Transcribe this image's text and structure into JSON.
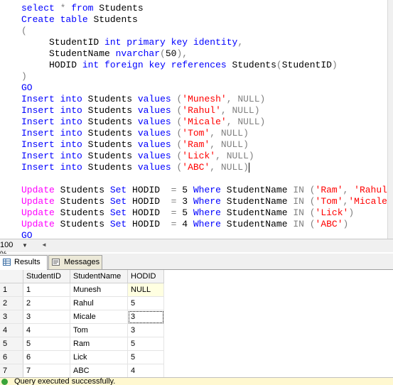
{
  "editor": {
    "lines": [
      {
        "segments": [
          {
            "t": "select",
            "c": "kw"
          },
          {
            "t": " ",
            "c": ""
          },
          {
            "t": "*",
            "c": "op"
          },
          {
            "t": " ",
            "c": ""
          },
          {
            "t": "from",
            "c": "kw"
          },
          {
            "t": " Students",
            "c": ""
          }
        ]
      },
      {
        "segments": [
          {
            "t": "Create",
            "c": "kw"
          },
          {
            "t": " ",
            "c": ""
          },
          {
            "t": "table",
            "c": "kw"
          },
          {
            "t": " Students",
            "c": ""
          }
        ]
      },
      {
        "segments": [
          {
            "t": "(",
            "c": "op"
          }
        ]
      },
      {
        "segments": [
          {
            "t": "     StudentID ",
            "c": ""
          },
          {
            "t": "int",
            "c": "kw"
          },
          {
            "t": " ",
            "c": ""
          },
          {
            "t": "primary",
            "c": "kw"
          },
          {
            "t": " ",
            "c": ""
          },
          {
            "t": "key",
            "c": "kw"
          },
          {
            "t": " ",
            "c": ""
          },
          {
            "t": "identity",
            "c": "kw"
          },
          {
            "t": ",",
            "c": "op"
          }
        ]
      },
      {
        "segments": [
          {
            "t": "     StudentName ",
            "c": ""
          },
          {
            "t": "nvarchar",
            "c": "kw"
          },
          {
            "t": "(",
            "c": "op"
          },
          {
            "t": "50",
            "c": ""
          },
          {
            "t": "),",
            "c": "op"
          }
        ]
      },
      {
        "segments": [
          {
            "t": "     HODID ",
            "c": ""
          },
          {
            "t": "int",
            "c": "kw"
          },
          {
            "t": " ",
            "c": ""
          },
          {
            "t": "foreign",
            "c": "kw"
          },
          {
            "t": " ",
            "c": ""
          },
          {
            "t": "key",
            "c": "kw"
          },
          {
            "t": " ",
            "c": ""
          },
          {
            "t": "references",
            "c": "kw"
          },
          {
            "t": " Students",
            "c": ""
          },
          {
            "t": "(",
            "c": "op"
          },
          {
            "t": "StudentID",
            "c": ""
          },
          {
            "t": ")",
            "c": "op"
          }
        ]
      },
      {
        "segments": [
          {
            "t": ")",
            "c": "op"
          }
        ]
      },
      {
        "segments": [
          {
            "t": "GO",
            "c": "kw"
          }
        ]
      },
      {
        "segments": [
          {
            "t": "Insert",
            "c": "kw"
          },
          {
            "t": " ",
            "c": ""
          },
          {
            "t": "into",
            "c": "kw"
          },
          {
            "t": " Students ",
            "c": ""
          },
          {
            "t": "values",
            "c": "kw"
          },
          {
            "t": " (",
            "c": "op"
          },
          {
            "t": "'Munesh'",
            "c": "str"
          },
          {
            "t": ", ",
            "c": "op"
          },
          {
            "t": "NULL",
            "c": "op"
          },
          {
            "t": ")",
            "c": "op"
          }
        ]
      },
      {
        "segments": [
          {
            "t": "Insert",
            "c": "kw"
          },
          {
            "t": " ",
            "c": ""
          },
          {
            "t": "into",
            "c": "kw"
          },
          {
            "t": " Students ",
            "c": ""
          },
          {
            "t": "values",
            "c": "kw"
          },
          {
            "t": " (",
            "c": "op"
          },
          {
            "t": "'Rahul'",
            "c": "str"
          },
          {
            "t": ", ",
            "c": "op"
          },
          {
            "t": "NULL",
            "c": "op"
          },
          {
            "t": ")",
            "c": "op"
          }
        ]
      },
      {
        "segments": [
          {
            "t": "Insert",
            "c": "kw"
          },
          {
            "t": " ",
            "c": ""
          },
          {
            "t": "into",
            "c": "kw"
          },
          {
            "t": " Students ",
            "c": ""
          },
          {
            "t": "values",
            "c": "kw"
          },
          {
            "t": " (",
            "c": "op"
          },
          {
            "t": "'Micale'",
            "c": "str"
          },
          {
            "t": ", ",
            "c": "op"
          },
          {
            "t": "NULL",
            "c": "op"
          },
          {
            "t": ")",
            "c": "op"
          }
        ]
      },
      {
        "segments": [
          {
            "t": "Insert",
            "c": "kw"
          },
          {
            "t": " ",
            "c": ""
          },
          {
            "t": "into",
            "c": "kw"
          },
          {
            "t": " Students ",
            "c": ""
          },
          {
            "t": "values",
            "c": "kw"
          },
          {
            "t": " (",
            "c": "op"
          },
          {
            "t": "'Tom'",
            "c": "str"
          },
          {
            "t": ", ",
            "c": "op"
          },
          {
            "t": "NULL",
            "c": "op"
          },
          {
            "t": ")",
            "c": "op"
          }
        ]
      },
      {
        "segments": [
          {
            "t": "Insert",
            "c": "kw"
          },
          {
            "t": " ",
            "c": ""
          },
          {
            "t": "into",
            "c": "kw"
          },
          {
            "t": " Students ",
            "c": ""
          },
          {
            "t": "values",
            "c": "kw"
          },
          {
            "t": " (",
            "c": "op"
          },
          {
            "t": "'Ram'",
            "c": "str"
          },
          {
            "t": ", ",
            "c": "op"
          },
          {
            "t": "NULL",
            "c": "op"
          },
          {
            "t": ")",
            "c": "op"
          }
        ]
      },
      {
        "segments": [
          {
            "t": "Insert",
            "c": "kw"
          },
          {
            "t": " ",
            "c": ""
          },
          {
            "t": "into",
            "c": "kw"
          },
          {
            "t": " Students ",
            "c": ""
          },
          {
            "t": "values",
            "c": "kw"
          },
          {
            "t": " (",
            "c": "op"
          },
          {
            "t": "'Lick'",
            "c": "str"
          },
          {
            "t": ", ",
            "c": "op"
          },
          {
            "t": "NULL",
            "c": "op"
          },
          {
            "t": ")",
            "c": "op"
          }
        ]
      },
      {
        "segments": [
          {
            "t": "Insert",
            "c": "kw"
          },
          {
            "t": " ",
            "c": ""
          },
          {
            "t": "into",
            "c": "kw"
          },
          {
            "t": " Students ",
            "c": ""
          },
          {
            "t": "values",
            "c": "kw"
          },
          {
            "t": " (",
            "c": "op"
          },
          {
            "t": "'ABC'",
            "c": "str"
          },
          {
            "t": ", ",
            "c": "op"
          },
          {
            "t": "NULL",
            "c": "op"
          },
          {
            "t": ")",
            "c": "op"
          }
        ],
        "caret": true
      },
      {
        "segments": []
      },
      {
        "segments": [
          {
            "t": "Update",
            "c": "fn"
          },
          {
            "t": " Students ",
            "c": ""
          },
          {
            "t": "Set",
            "c": "kw"
          },
          {
            "t": " HODID  ",
            "c": ""
          },
          {
            "t": "=",
            "c": "op"
          },
          {
            "t": " 5 ",
            "c": ""
          },
          {
            "t": "Where",
            "c": "kw"
          },
          {
            "t": " StudentName ",
            "c": ""
          },
          {
            "t": "IN",
            "c": "op"
          },
          {
            "t": " (",
            "c": "op"
          },
          {
            "t": "'Ram'",
            "c": "str"
          },
          {
            "t": ", ",
            "c": "op"
          },
          {
            "t": "'Rahul'",
            "c": "str"
          },
          {
            "t": ")",
            "c": "op"
          }
        ]
      },
      {
        "segments": [
          {
            "t": "Update",
            "c": "fn"
          },
          {
            "t": " Students ",
            "c": ""
          },
          {
            "t": "Set",
            "c": "kw"
          },
          {
            "t": " HODID  ",
            "c": ""
          },
          {
            "t": "=",
            "c": "op"
          },
          {
            "t": " 3 ",
            "c": ""
          },
          {
            "t": "Where",
            "c": "kw"
          },
          {
            "t": " StudentName ",
            "c": ""
          },
          {
            "t": "IN",
            "c": "op"
          },
          {
            "t": " (",
            "c": "op"
          },
          {
            "t": "'Tom'",
            "c": "str"
          },
          {
            "t": ",",
            "c": "op"
          },
          {
            "t": "'Micale'",
            "c": "str"
          },
          {
            "t": ")",
            "c": "op"
          }
        ]
      },
      {
        "segments": [
          {
            "t": "Update",
            "c": "fn"
          },
          {
            "t": " Students ",
            "c": ""
          },
          {
            "t": "Set",
            "c": "kw"
          },
          {
            "t": " HODID  ",
            "c": ""
          },
          {
            "t": "=",
            "c": "op"
          },
          {
            "t": " 5 ",
            "c": ""
          },
          {
            "t": "Where",
            "c": "kw"
          },
          {
            "t": " StudentName ",
            "c": ""
          },
          {
            "t": "IN",
            "c": "op"
          },
          {
            "t": " (",
            "c": "op"
          },
          {
            "t": "'Lick'",
            "c": "str"
          },
          {
            "t": ")",
            "c": "op"
          }
        ]
      },
      {
        "segments": [
          {
            "t": "Update",
            "c": "fn"
          },
          {
            "t": " Students ",
            "c": ""
          },
          {
            "t": "Set",
            "c": "kw"
          },
          {
            "t": " HODID  ",
            "c": ""
          },
          {
            "t": "=",
            "c": "op"
          },
          {
            "t": " 4 ",
            "c": ""
          },
          {
            "t": "Where",
            "c": "kw"
          },
          {
            "t": " StudentName ",
            "c": ""
          },
          {
            "t": "IN",
            "c": "op"
          },
          {
            "t": " (",
            "c": "op"
          },
          {
            "t": "'ABC'",
            "c": "str"
          },
          {
            "t": ")",
            "c": "op"
          }
        ]
      },
      {
        "segments": [
          {
            "t": "GO",
            "c": "kw"
          }
        ]
      }
    ]
  },
  "statusbar": {
    "zoom": "100 %"
  },
  "tabs": {
    "results_label": "Results",
    "messages_label": "Messages"
  },
  "grid": {
    "columns": [
      "StudentID",
      "StudentName",
      "HODID"
    ],
    "rows": [
      {
        "num": "1",
        "cells": [
          "1",
          "Munesh",
          "NULL"
        ]
      },
      {
        "num": "2",
        "cells": [
          "2",
          "Rahul",
          "5"
        ]
      },
      {
        "num": "3",
        "cells": [
          "3",
          "Micale",
          "3"
        ]
      },
      {
        "num": "4",
        "cells": [
          "4",
          "Tom",
          "3"
        ]
      },
      {
        "num": "5",
        "cells": [
          "5",
          "Ram",
          "5"
        ]
      },
      {
        "num": "6",
        "cells": [
          "6",
          "Lick",
          "5"
        ]
      },
      {
        "num": "7",
        "cells": [
          "7",
          "ABC",
          "4"
        ]
      }
    ]
  },
  "bottom": {
    "message": "Query executed successfully."
  },
  "colors": {
    "keyword": "#0000ff",
    "string": "#ff0000",
    "operator": "#808080",
    "function": "#ff00ff"
  }
}
